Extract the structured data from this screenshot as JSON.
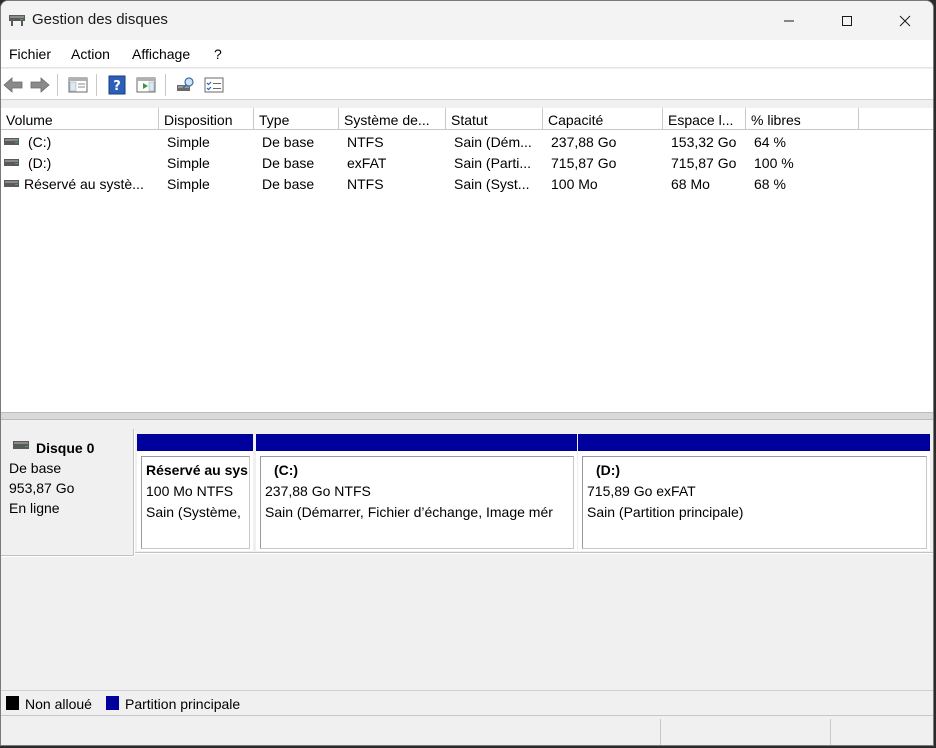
{
  "window": {
    "title": "Gestion des disques"
  },
  "menu": [
    "Fichier",
    "Action",
    "Affichage",
    "?"
  ],
  "toolbar": {
    "icons": [
      "back-icon",
      "forward-icon",
      "console-tree-icon",
      "help-icon",
      "action-pane-icon",
      "rescan-disks-icon",
      "properties-icon"
    ]
  },
  "columns": [
    "Volume",
    "Disposition",
    "Type",
    "Système de...",
    "Statut",
    "Capacité",
    "Espace l...",
    "% libres"
  ],
  "volumes": [
    {
      "volume": "(C:)",
      "disposition": "Simple",
      "type": "De base",
      "fs": "NTFS",
      "status": "Sain (Dém...",
      "capacity": "237,88 Go",
      "free": "153,32 Go",
      "pct": "64 %"
    },
    {
      "volume": "(D:)",
      "disposition": "Simple",
      "type": "De base",
      "fs": "exFAT",
      "status": "Sain (Parti...",
      "capacity": "715,87 Go",
      "free": "715,87 Go",
      "pct": "100 %"
    },
    {
      "volume": "Réservé au systè...",
      "disposition": "Simple",
      "type": "De base",
      "fs": "NTFS",
      "status": "Sain (Syst...",
      "capacity": "100 Mo",
      "free": "68 Mo",
      "pct": "68 %"
    }
  ],
  "disk": {
    "name": "Disque 0",
    "type": "De base",
    "size": "953,87 Go",
    "state": "En ligne"
  },
  "partitions": [
    {
      "name": "Réservé au sys",
      "detail": "100 Mo NTFS",
      "status": "Sain (Système,"
    },
    {
      "name": "(C:)",
      "detail": "237,88 Go NTFS",
      "status": "Sain (Démarrer, Fichier d’échange, Image mér"
    },
    {
      "name": "(D:)",
      "detail": "715,89 Go exFAT",
      "status": "Sain (Partition principale)"
    }
  ],
  "legend": [
    {
      "label": "Non alloué",
      "color": "#000000"
    },
    {
      "label": "Partition principale",
      "color": "#00009c"
    }
  ],
  "colors": {
    "partition_bar": "#00009c",
    "window_bg": "#f0f0f0"
  }
}
